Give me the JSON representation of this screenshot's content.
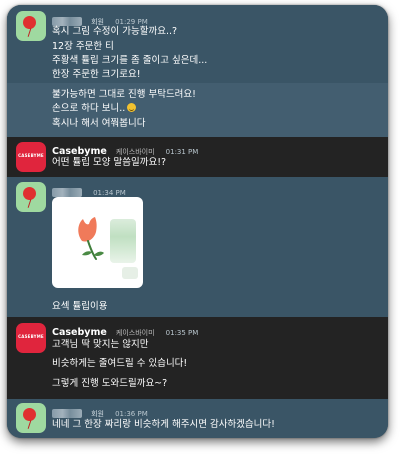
{
  "messages": [
    {
      "sender_role": "회원",
      "time": "01:29 PM",
      "lines": [
        "혹시 그림 수정이 가능할까요..?",
        "12장 주문한 티",
        "주황색 튤립 크기를 좀 줄이고 싶은데...",
        "한장 주문한 크기로요!"
      ]
    },
    {
      "lines": [
        "불가능하면 그대로 진행 부탁드려요!",
        "손으로 하다 보니..",
        "혹시나 해서 여쭤봅니다"
      ]
    },
    {
      "sender_name": "Casebyme",
      "sender_sub": "케이스바이미",
      "time": "01:31 PM",
      "avatar_text": "CASEBYME",
      "lines": [
        "어떤 튤립 모양 말씀일까요!?"
      ]
    },
    {
      "sender_role": "회원",
      "time": "01:34 PM",
      "lines": [
        "요섹 튤립이용"
      ]
    },
    {
      "sender_name": "Casebyme",
      "sender_sub": "케이스바이미",
      "time": "01:35 PM",
      "avatar_text": "CASEBYME",
      "lines": [
        "고객님 딱 맞지는 않지만",
        "비슷하게는 줄여드릴 수 있습니다!",
        "그렇게 진행 도와드릴까요~?"
      ]
    },
    {
      "sender_role": "회원",
      "time": "01:36 PM",
      "lines": [
        "네네 그 한장 짜리랑 비슷하게 해주시면 감사하겠습니다!"
      ]
    }
  ],
  "colors": {
    "user_bg": "#3a5566",
    "user_bg_alt": "#435e70",
    "business_bg": "#232323",
    "business_avatar": "#e0253d",
    "user_avatar": "#9fd9a0"
  },
  "icons": {
    "user_avatar": "red-balloon-icon",
    "emoji": "sweat-smile-emoji"
  }
}
